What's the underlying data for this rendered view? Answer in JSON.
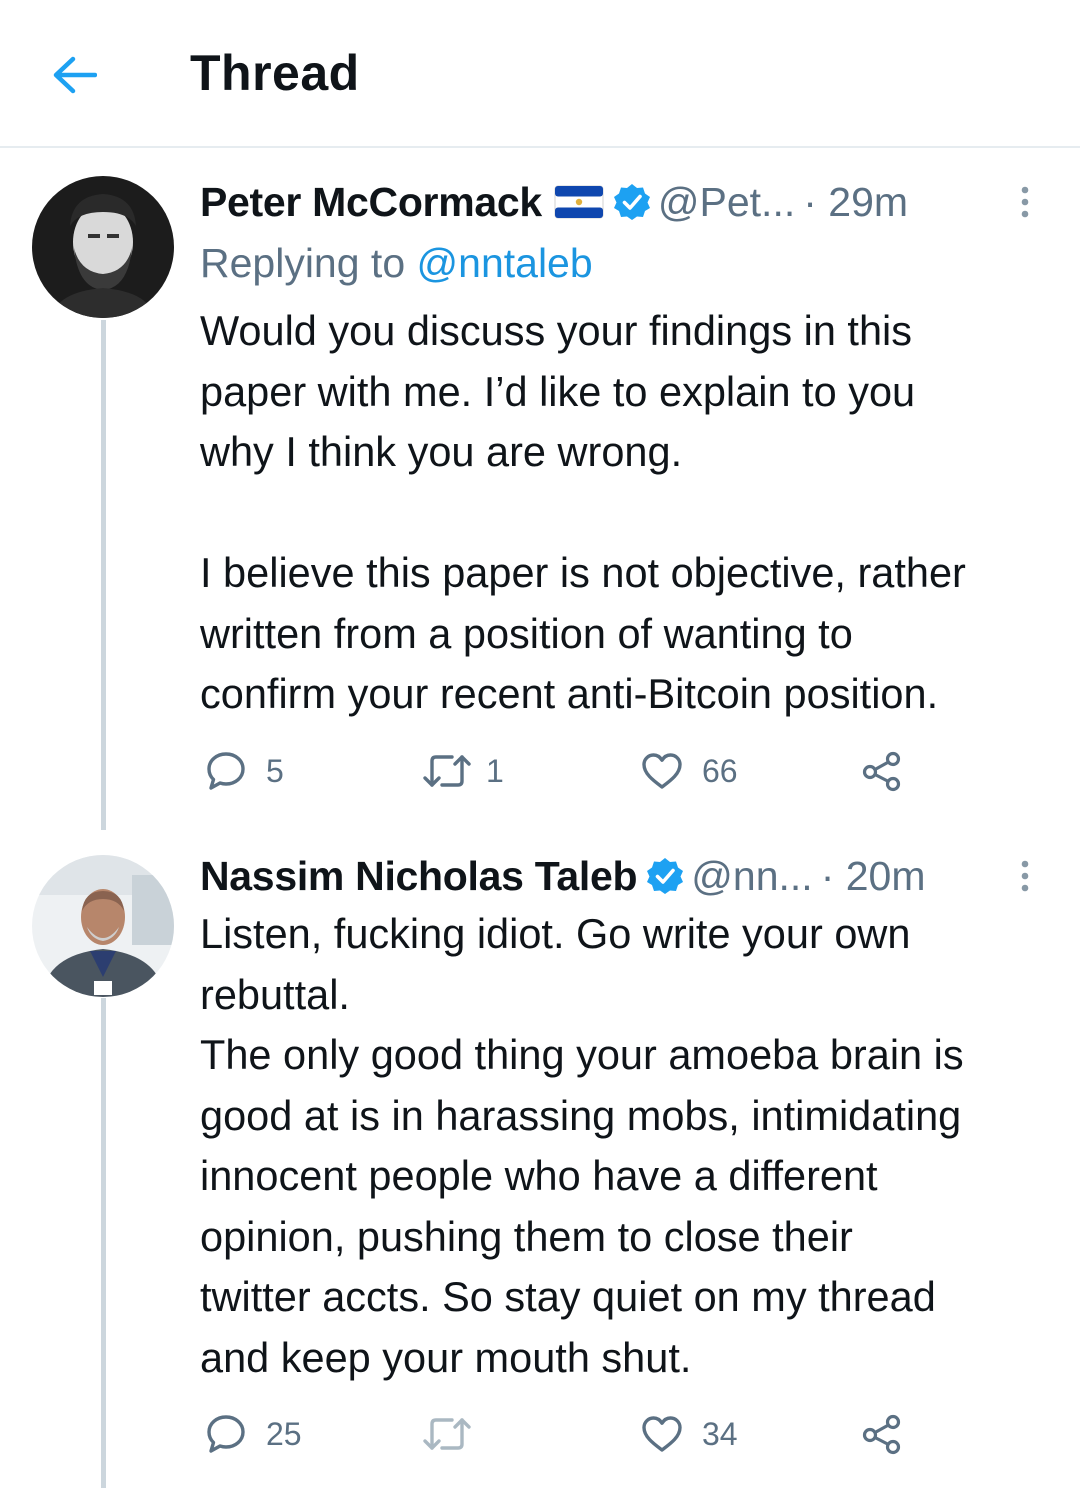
{
  "header": {
    "title": "Thread",
    "back_icon": "arrow-left-icon",
    "accent_color": "#1da1f2"
  },
  "tweets": [
    {
      "name": "Peter McCormack",
      "flag_icon": "el-salvador-flag-icon",
      "verified_icon": "verified-badge-icon",
      "handle": "@Pet...",
      "time": "· 29m",
      "replying_prefix": "Replying to",
      "replying_to": "@nntaleb",
      "text": "Would you discuss your findings in this\npaper with me. I’d like to explain to you\nwhy I think you are wrong.\n\nI believe this paper is not objective, rather\nwritten from a position of wanting to\nconfirm your recent anti-Bitcoin position.",
      "replies": "5",
      "retweets": "1",
      "likes": "66"
    },
    {
      "name": "Nassim Nicholas Taleb",
      "verified_icon": "verified-badge-icon",
      "handle": "@nn...",
      "time": "· 20m",
      "text": "Listen, fucking idiot. Go write your own\nrebuttal.\nThe only good thing your amoeba brain is\ngood at is in harassing mobs, intimidating\ninnocent people who have a different\nopinion, pushing them to close their\ntwitter accts. So stay quiet on my thread\nand keep your mouth shut.",
      "replies": "25",
      "retweets": "",
      "likes": "34"
    }
  ],
  "colors": {
    "verified": "#1da1f2",
    "secondary_text": "#5b7083",
    "mention": "#1b95e0",
    "thread_line": "#ccd6dd"
  }
}
